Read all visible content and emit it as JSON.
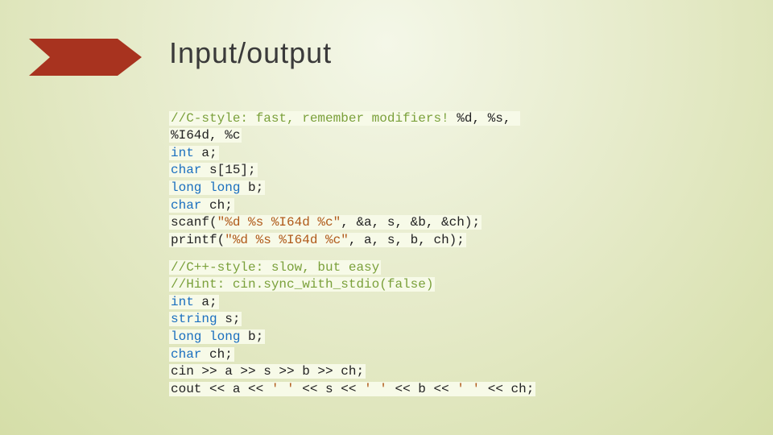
{
  "title": "Input/output",
  "block1": {
    "l1_a": "//C-style: fast, remember modifiers!",
    "l1_b": " %d, %s, ",
    "l2": "%I64d, %c",
    "l3_kw": "int",
    "l3_rest": " a;",
    "l4_kw": "char",
    "l4_rest": " s[15];",
    "l5_kw1": "long",
    "l5_sp": " ",
    "l5_kw2": "long",
    "l5_rest": " b;",
    "l6_kw": "char",
    "l6_rest": " ch;",
    "l7_a": "scanf(",
    "l7_b": "\"%d %s %I64d %c\"",
    "l7_c": ", &a, s, &b, &ch);",
    "l8_a": "printf(",
    "l8_b": "\"%d %s %I64d %c\"",
    "l8_c": ", a, s, b, ch);"
  },
  "block2": {
    "l1": "//C++-style: slow, but easy",
    "l2": "//Hint: cin.sync_with_stdio(false)",
    "l3_kw": "int",
    "l3_rest": " a;",
    "l4_kw": "string",
    "l4_rest": " s;",
    "l5_kw1": "long",
    "l5_sp": " ",
    "l5_kw2": "long",
    "l5_rest": " b;",
    "l6_kw": "char",
    "l6_rest": " ch;",
    "l7": "cin >> a >> s >> b >> ch;",
    "l8_a": "cout << a << ",
    "l8_b": "' '",
    "l8_c": " << s << ",
    "l8_d": "' '",
    "l8_e": " << b << ",
    "l8_f": "' '",
    "l8_g": " << ch;"
  }
}
